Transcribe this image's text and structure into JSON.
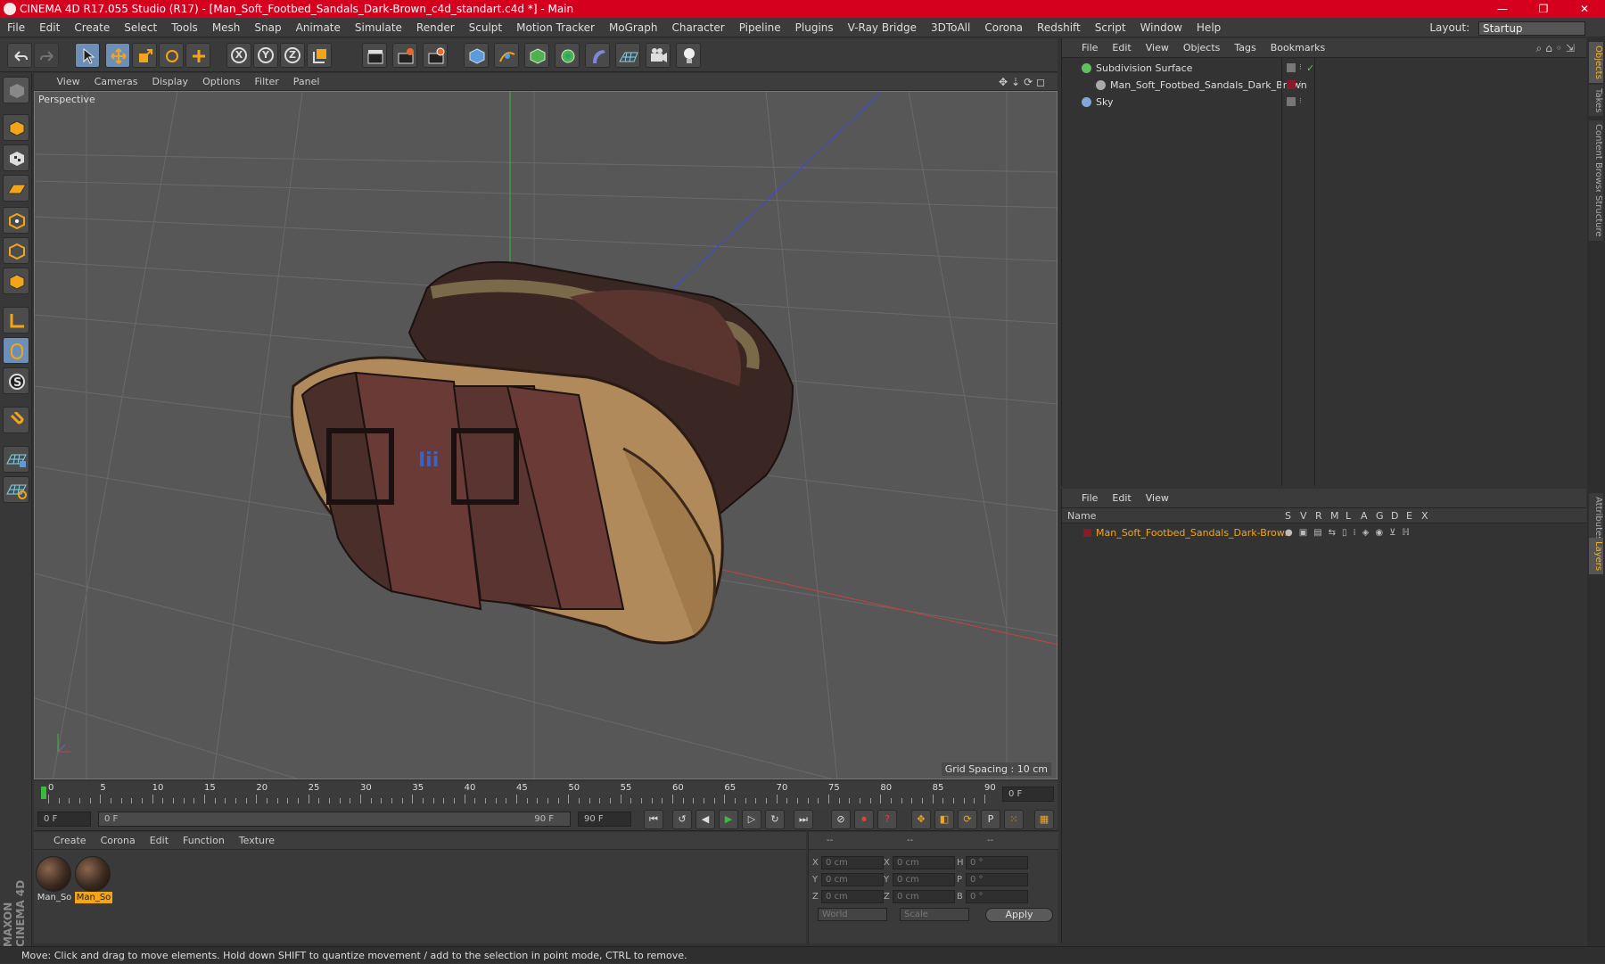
{
  "window": {
    "title": "CINEMA 4D R17.055 Studio (R17) - [Man_Soft_Footbed_Sandals_Dark-Brown_c4d_standart.c4d *] - Main",
    "controls": [
      "—",
      "❐",
      "✕"
    ]
  },
  "menu": [
    "File",
    "Edit",
    "Create",
    "Select",
    "Tools",
    "Mesh",
    "Snap",
    "Animate",
    "Simulate",
    "Render",
    "Sculpt",
    "Motion Tracker",
    "MoGraph",
    "Character",
    "Pipeline",
    "Plugins",
    "V-Ray Bridge",
    "3DToAll",
    "Corona",
    "Redshift",
    "Script",
    "Window",
    "Help"
  ],
  "layout": {
    "label": "Layout:",
    "value": "Startup"
  },
  "viewport": {
    "menu": [
      "View",
      "Cameras",
      "Display",
      "Options",
      "Filter",
      "Panel"
    ],
    "label": "Perspective",
    "grid_spacing": "Grid Spacing : 10 cm"
  },
  "timeline": {
    "ticks": [
      "0",
      "5",
      "10",
      "15",
      "20",
      "25",
      "30",
      "35",
      "40",
      "45",
      "50",
      "55",
      "60",
      "65",
      "70",
      "75",
      "80",
      "85",
      "90"
    ],
    "current_frame": "0 F"
  },
  "transport": {
    "start": "0 F",
    "range_start": "0 F",
    "range_end": "90 F",
    "end": "90 F"
  },
  "materials": {
    "menu": [
      "Create",
      "Corona",
      "Edit",
      "Function",
      "Texture"
    ],
    "items": [
      {
        "name": "Man_So",
        "selected": false
      },
      {
        "name": "Man_So",
        "selected": true
      }
    ]
  },
  "coordinates": {
    "header": [
      "--",
      "--",
      "--"
    ],
    "rows": [
      {
        "a": "X",
        "v1": "0 cm",
        "b": "X",
        "v2": "0 cm",
        "c": "H",
        "v3": "0 °"
      },
      {
        "a": "Y",
        "v1": "0 cm",
        "b": "Y",
        "v2": "0 cm",
        "c": "P",
        "v3": "0 °"
      },
      {
        "a": "Z",
        "v1": "0 cm",
        "b": "Z",
        "v2": "0 cm",
        "c": "B",
        "v3": "0 °"
      }
    ],
    "mode1": "World",
    "mode2": "Scale",
    "apply": "Apply"
  },
  "object_manager": {
    "menu": [
      "File",
      "Edit",
      "View",
      "Objects",
      "Tags",
      "Bookmarks"
    ],
    "objects": [
      {
        "name": "Subdivision Surface",
        "icon_color": "#5fbf5f"
      },
      {
        "name": "Man_Soft_Footbed_Sandals_Dark_Brown",
        "icon_color": "#aaaaaa"
      },
      {
        "name": "Sky",
        "icon_color": "#7fa8d8"
      }
    ]
  },
  "layer_manager": {
    "menu": [
      "File",
      "Edit",
      "View"
    ],
    "columns": [
      "Name",
      "S",
      "V",
      "R",
      "M",
      "L",
      "A",
      "G",
      "D",
      "E",
      "X"
    ],
    "layers": [
      {
        "name": "Man_Soft_Footbed_Sandals_Dark-Brown",
        "color": "#8a1a2a"
      }
    ]
  },
  "right_tabs": [
    "Objects",
    "Takes",
    "Content Browser",
    "Structure",
    "Attributes",
    "Layers"
  ],
  "status": "Move: Click and drag to move elements. Hold down SHIFT to quantize movement / add to the selection in point mode, CTRL to remove.",
  "branding": "MAXON CINEMA 4D",
  "colors": {
    "titlebar": "#d4001e",
    "accent": "#f3a51a",
    "selection": "#6d8fb7"
  }
}
